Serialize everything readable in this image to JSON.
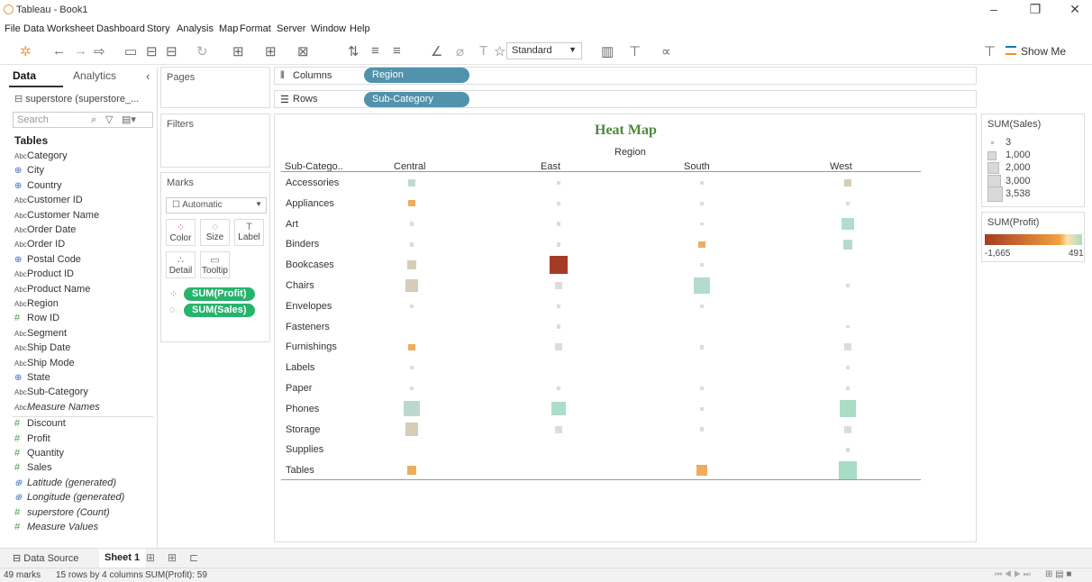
{
  "window": {
    "title": "Tableau - Book1",
    "minimize": "–",
    "restore": "❐",
    "close": "✕"
  },
  "menu": [
    "File",
    "Data",
    "Worksheet",
    "Dashboard",
    "Story",
    "Analysis",
    "Map",
    "Format",
    "Server",
    "Window",
    "Help"
  ],
  "toolbar": {
    "fit": "Standard",
    "show_me": "Show Me"
  },
  "data_pane": {
    "tab_data": "Data",
    "tab_analytics": "Analytics",
    "collapse": "‹",
    "datasource": "superstore (superstore_...",
    "search_placeholder": "Search",
    "tables_heading": "Tables",
    "fields": [
      {
        "type": "Abc",
        "name": "Category"
      },
      {
        "type": "geo",
        "name": "City"
      },
      {
        "type": "geo",
        "name": "Country"
      },
      {
        "type": "Abc",
        "name": "Customer ID"
      },
      {
        "type": "Abc",
        "name": "Customer Name"
      },
      {
        "type": "Abc",
        "name": "Order Date"
      },
      {
        "type": "Abc",
        "name": "Order ID"
      },
      {
        "type": "geo",
        "name": "Postal Code"
      },
      {
        "type": "Abc",
        "name": "Product ID"
      },
      {
        "type": "Abc",
        "name": "Product Name"
      },
      {
        "type": "Abc",
        "name": "Region"
      },
      {
        "type": "#",
        "name": "Row ID"
      },
      {
        "type": "Abc",
        "name": "Segment"
      },
      {
        "type": "Abc",
        "name": "Ship Date"
      },
      {
        "type": "Abc",
        "name": "Ship Mode"
      },
      {
        "type": "geo",
        "name": "State"
      },
      {
        "type": "Abc",
        "name": "Sub-Category"
      },
      {
        "type": "Abc",
        "name": "Measure Names",
        "italic": true
      }
    ],
    "measures": [
      {
        "type": "#",
        "name": "Discount"
      },
      {
        "type": "#",
        "name": "Profit"
      },
      {
        "type": "#",
        "name": "Quantity"
      },
      {
        "type": "#",
        "name": "Sales"
      },
      {
        "type": "geo",
        "name": "Latitude (generated)",
        "italic": true
      },
      {
        "type": "geo",
        "name": "Longitude (generated)",
        "italic": true
      },
      {
        "type": "#",
        "name": "superstore (Count)",
        "italic": true
      },
      {
        "type": "#",
        "name": "Measure Values",
        "italic": true
      }
    ]
  },
  "cards": {
    "pages": "Pages",
    "filters": "Filters",
    "marks": "Marks",
    "mark_type": "Automatic",
    "buttons": [
      "Color",
      "Size",
      "Label",
      "Detail",
      "Tooltip"
    ],
    "pills": [
      "SUM(Profit)",
      "SUM(Sales)"
    ]
  },
  "shelves": {
    "columns_label": "Columns",
    "columns_pill": "Region",
    "rows_label": "Rows",
    "rows_pill": "Sub-Category"
  },
  "view": {
    "title": "Heat Map",
    "column_header": "Region",
    "row_header": "Sub-Catego.."
  },
  "chart_data": {
    "type": "heatmap",
    "title": "Heat Map",
    "xlabel": "Region",
    "ylabel": "Sub-Catego..",
    "x": [
      "Central",
      "East",
      "South",
      "West"
    ],
    "y": [
      "Accessories",
      "Appliances",
      "Art",
      "Binders",
      "Bookcases",
      "Chairs",
      "Envelopes",
      "Fasteners",
      "Furnishings",
      "Labels",
      "Paper",
      "Phones",
      "Storage",
      "Supplies",
      "Tables"
    ],
    "size_measure": "SUM(Sales)",
    "color_measure": "SUM(Profit)",
    "color_range": [
      -1665,
      491
    ],
    "colors": {
      "negative": "#a53b26",
      "mid": "#f2a23d",
      "positive": "#a8dcc6"
    },
    "cells": [
      {
        "row": "Accessories",
        "col": "Central",
        "size": 300,
        "profit": 70
      },
      {
        "row": "Accessories",
        "col": "East",
        "size": 20,
        "profit": 0
      },
      {
        "row": "Accessories",
        "col": "South",
        "size": 20,
        "profit": 0
      },
      {
        "row": "Accessories",
        "col": "West",
        "size": 300,
        "profit": 30
      },
      {
        "row": "Appliances",
        "col": "Central",
        "size": 200,
        "profit": -80
      },
      {
        "row": "Appliances",
        "col": "East",
        "size": 20,
        "profit": 0
      },
      {
        "row": "Appliances",
        "col": "South",
        "size": 20,
        "profit": 0
      },
      {
        "row": "Appliances",
        "col": "West",
        "size": 20,
        "profit": 0
      },
      {
        "row": "Art",
        "col": "Central",
        "size": 20,
        "profit": 0
      },
      {
        "row": "Art",
        "col": "East",
        "size": 20,
        "profit": 0
      },
      {
        "row": "Art",
        "col": "South",
        "size": 5,
        "profit": 0
      },
      {
        "row": "Art",
        "col": "West",
        "size": 1300,
        "profit": 280
      },
      {
        "row": "Binders",
        "col": "Central",
        "size": 20,
        "profit": 0
      },
      {
        "row": "Binders",
        "col": "East",
        "size": 20,
        "profit": 0
      },
      {
        "row": "Binders",
        "col": "South",
        "size": 200,
        "profit": -60
      },
      {
        "row": "Binders",
        "col": "West",
        "size": 700,
        "profit": 260
      },
      {
        "row": "Bookcases",
        "col": "Central",
        "size": 600,
        "profit": 20
      },
      {
        "row": "Bookcases",
        "col": "East",
        "size": 3538,
        "profit": -1665
      },
      {
        "row": "Bookcases",
        "col": "South",
        "size": 20,
        "profit": 0
      },
      {
        "row": "Chairs",
        "col": "Central",
        "size": 1500,
        "profit": 30
      },
      {
        "row": "Chairs",
        "col": "East",
        "size": 300,
        "profit": 0
      },
      {
        "row": "Chairs",
        "col": "South",
        "size": 2500,
        "profit": 250
      },
      {
        "row": "Chairs",
        "col": "West",
        "size": 20,
        "profit": 0
      },
      {
        "row": "Envelopes",
        "col": "Central",
        "size": 20,
        "profit": 0
      },
      {
        "row": "Envelopes",
        "col": "East",
        "size": 20,
        "profit": 0
      },
      {
        "row": "Envelopes",
        "col": "South",
        "size": 20,
        "profit": 0
      },
      {
        "row": "Fasteners",
        "col": "East",
        "size": 20,
        "profit": 0
      },
      {
        "row": "Fasteners",
        "col": "West",
        "size": 5,
        "profit": 0
      },
      {
        "row": "Furnishings",
        "col": "Central",
        "size": 200,
        "profit": -80
      },
      {
        "row": "Furnishings",
        "col": "East",
        "size": 300,
        "profit": 0
      },
      {
        "row": "Furnishings",
        "col": "South",
        "size": 20,
        "profit": 0
      },
      {
        "row": "Furnishings",
        "col": "West",
        "size": 300,
        "profit": 0
      },
      {
        "row": "Labels",
        "col": "Central",
        "size": 20,
        "profit": 0
      },
      {
        "row": "Labels",
        "col": "West",
        "size": 5,
        "profit": 0
      },
      {
        "row": "Paper",
        "col": "Central",
        "size": 20,
        "profit": 0
      },
      {
        "row": "Paper",
        "col": "East",
        "size": 20,
        "profit": 0
      },
      {
        "row": "Paper",
        "col": "South",
        "size": 20,
        "profit": 0
      },
      {
        "row": "Paper",
        "col": "West",
        "size": 20,
        "profit": 0
      },
      {
        "row": "Phones",
        "col": "Central",
        "size": 2500,
        "profit": 180
      },
      {
        "row": "Phones",
        "col": "East",
        "size": 1800,
        "profit": 400
      },
      {
        "row": "Phones",
        "col": "South",
        "size": 5,
        "profit": 0
      },
      {
        "row": "Phones",
        "col": "West",
        "size": 3000,
        "profit": 420
      },
      {
        "row": "Storage",
        "col": "Central",
        "size": 1600,
        "profit": 20
      },
      {
        "row": "Storage",
        "col": "East",
        "size": 300,
        "profit": 0
      },
      {
        "row": "Storage",
        "col": "South",
        "size": 20,
        "profit": 0
      },
      {
        "row": "Storage",
        "col": "West",
        "size": 300,
        "profit": 0
      },
      {
        "row": "Supplies",
        "col": "West",
        "size": 20,
        "profit": 0
      },
      {
        "row": "Tables",
        "col": "Central",
        "size": 600,
        "profit": -150
      },
      {
        "row": "Tables",
        "col": "South",
        "size": 1000,
        "profit": -150
      },
      {
        "row": "Tables",
        "col": "West",
        "size": 3538,
        "profit": 491
      }
    ],
    "legend_placement": "right"
  },
  "legends": {
    "size_title": "SUM(Sales)",
    "size_items": [
      "3",
      "1,000",
      "2,000",
      "3,000",
      "3,538"
    ],
    "color_title": "SUM(Profit)",
    "color_min": "-1,665",
    "color_max": "491"
  },
  "bottom": {
    "data_source_tab": "Data Source",
    "sheet_tab": "Sheet 1",
    "status_marks": "49 marks",
    "status_dims": "15 rows by 4 columns",
    "status_sum": "SUM(Profit): 59"
  }
}
